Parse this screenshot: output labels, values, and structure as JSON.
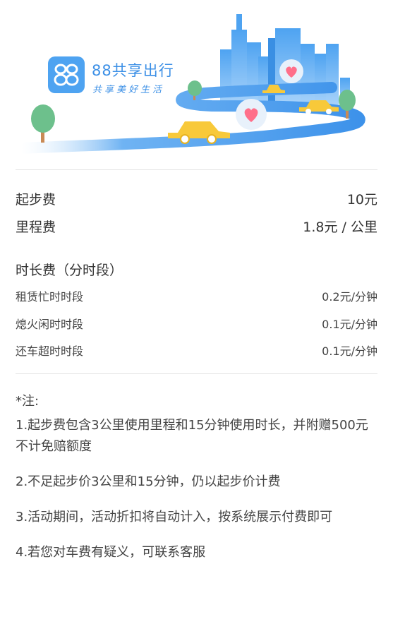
{
  "brand": {
    "logo_icon": "88-logo-icon",
    "title": "88共享出行",
    "slogan": "共享美好生活",
    "accent_color": "#3b8fe6"
  },
  "fees": {
    "base": {
      "label": "起步费",
      "value": "10元"
    },
    "mileage": {
      "label": "里程费",
      "value": "1.8元 / 公里"
    },
    "duration_title": "时长费（分时段）",
    "periods": [
      {
        "label": "租赁忙时时段",
        "value": "0.2元/分钟"
      },
      {
        "label": "熄火闲时时段",
        "value": "0.1元/分钟"
      },
      {
        "label": "还车超时时段",
        "value": "0.1元/分钟"
      }
    ]
  },
  "notes": {
    "heading": "*注:",
    "items": [
      "1.起步费包含3公里使用里程和15分钟使用时长，并附赠500元不计免赔额度",
      "2.不足起步价3公里和15分钟，仍以起步价计费",
      "3.活动期间，活动折扣将自动计入，按系统展示付费即可",
      "4.若您对车费有疑义，可联系客服"
    ]
  }
}
